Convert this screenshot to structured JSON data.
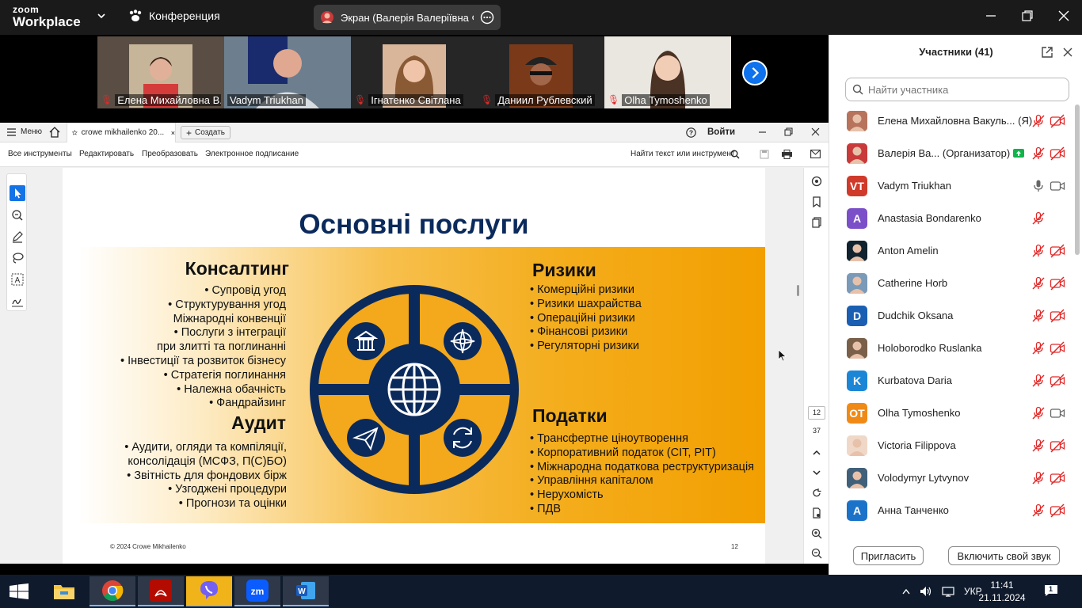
{
  "app": {
    "logo_line1": "zoom",
    "logo_line2": "Workplace",
    "meeting_title": "Конференция",
    "screen_share_label": "Экран (Валерія Валеріївна Фесе"
  },
  "video_strip": [
    {
      "name": "Елена Михайловна В...",
      "muted": true,
      "active": false
    },
    {
      "name": "Vadym Triukhan",
      "muted": false,
      "active": true
    },
    {
      "name": "Ігнатенко Світлана",
      "muted": true,
      "active": false
    },
    {
      "name": "Даниил Рублевский",
      "muted": true,
      "active": false
    },
    {
      "name": "Olha Tymoshenko",
      "muted": true,
      "active": false
    }
  ],
  "pdf_viewer": {
    "menu_label": "Меню",
    "tab_label": "crowe mikhailenko 20...",
    "new_tab_label": "Создать",
    "login_label": "Войти",
    "toolbar": [
      "Все инструменты",
      "Редактировать",
      "Преобразовать",
      "Электронное подписание"
    ],
    "find_label": "Найти текст или инструмент",
    "page_current": "12",
    "page_total": "37"
  },
  "slide": {
    "title": "Основні послуги",
    "consulting": {
      "heading": "Консалтинг",
      "items": [
        "• Супровід угод",
        "• Структурування угод",
        "Міжнародні конвенції",
        "• Послуги з інтеграції",
        "при злитті та поглинанні",
        "• Інвестиції та розвиток бізнесу",
        "• Стратегія поглинання",
        "• Належна обачність",
        "• Фандрайзинг"
      ]
    },
    "audit": {
      "heading": "Аудит",
      "items": [
        "• Аудити, огляди та компіляції,",
        "консолідація (МСФЗ, П(С)БО)",
        "• Звітність для фондових бірж",
        "• Узгоджені процедури",
        "• Прогнози та оцінки"
      ]
    },
    "risks": {
      "heading": "Ризики",
      "items": [
        "• Комерційні ризики",
        "• Ризики шахрайства",
        "• Операційні ризики",
        "• Фінансові ризики",
        "• Регуляторні ризики"
      ]
    },
    "taxes": {
      "heading": "Податки",
      "items": [
        "• Трансфертне ціноутворення",
        "• Корпоративний податок (CIT, PIT)",
        "• Міжнародна податкова реструктуризація",
        "• Управління капіталом",
        "• Нерухомість",
        "• ПДВ"
      ]
    },
    "footer_left": "© 2024 Crowe Mikhailenko",
    "footer_right": "12",
    "colors": {
      "navy": "#0b2a5c",
      "gold": "#f4a81c"
    }
  },
  "participants": {
    "title": "Участники (41)",
    "search_placeholder": "Найти участника",
    "invite_label": "Пригласить",
    "unmute_label": "Включить свой звук",
    "list": [
      {
        "name": "Елена Михайловна Вакуль...",
        "tag": "(Я)",
        "initials": "",
        "color": "#b8735c",
        "photo": true,
        "mic": "muted",
        "video": "off"
      },
      {
        "name": "Валерія Ва...",
        "tag": "(Организатор)",
        "initials": "",
        "color": "#c93a3a",
        "photo": true,
        "mic": "muted",
        "video": "off",
        "sharing": true
      },
      {
        "name": "Vadym Triukhan",
        "tag": "",
        "initials": "VT",
        "color": "#d03a2a",
        "photo": false,
        "mic": "on",
        "video": "on"
      },
      {
        "name": "Anastasia Bondarenko",
        "tag": "",
        "initials": "A",
        "color": "#7b4fc8",
        "photo": false,
        "mic": "muted",
        "video": "none"
      },
      {
        "name": "Anton Amelin",
        "tag": "",
        "initials": "",
        "color": "#10232e",
        "photo": true,
        "mic": "muted",
        "video": "off"
      },
      {
        "name": "Catherine Horb",
        "tag": "",
        "initials": "",
        "color": "#7a9ab8",
        "photo": true,
        "mic": "muted",
        "video": "off"
      },
      {
        "name": "Dudchik Oksana",
        "tag": "",
        "initials": "D",
        "color": "#1b5fb3",
        "photo": false,
        "mic": "muted",
        "video": "off"
      },
      {
        "name": "Holoborodko Ruslanka",
        "tag": "",
        "initials": "",
        "color": "#7a6048",
        "photo": true,
        "mic": "muted",
        "video": "off"
      },
      {
        "name": "Kurbatova Daria",
        "tag": "",
        "initials": "K",
        "color": "#1c86d6",
        "photo": false,
        "mic": "muted",
        "video": "off"
      },
      {
        "name": "Olha Tymoshenko",
        "tag": "",
        "initials": "OT",
        "color": "#f08a16",
        "photo": false,
        "mic": "muted",
        "video": "on"
      },
      {
        "name": "Victoria Filippova",
        "tag": "",
        "initials": "",
        "color": "#f0d8c8",
        "photo": true,
        "mic": "muted",
        "video": "off"
      },
      {
        "name": "Volodymyr Lytvynov",
        "tag": "",
        "initials": "",
        "color": "#40607a",
        "photo": true,
        "mic": "muted",
        "video": "off"
      },
      {
        "name": "Анна Танченко",
        "tag": "",
        "initials": "A",
        "color": "#1b73c9",
        "photo": false,
        "mic": "muted",
        "video": "off"
      }
    ]
  },
  "taskbar": {
    "language": "УКР",
    "time": "11:41",
    "date": "21.11.2024",
    "notifications": "1"
  }
}
